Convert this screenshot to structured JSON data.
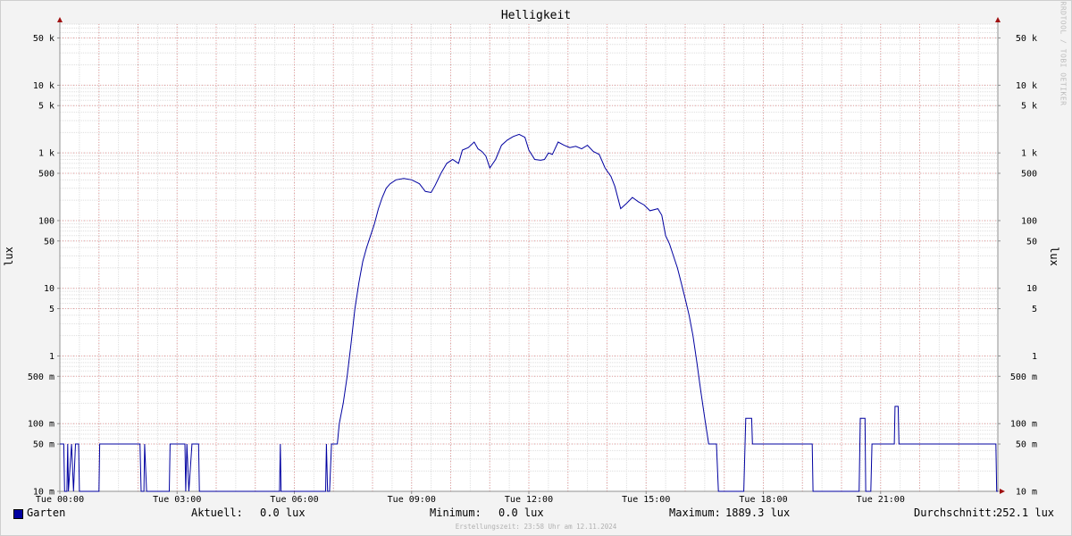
{
  "chart_data": {
    "type": "line",
    "title": "Helligkeit",
    "ylabel": "lux",
    "y_scale": "log",
    "ylim": [
      10,
      80000
    ],
    "grid": true,
    "y_ticks": [
      {
        "value": 50000,
        "label": "50 k"
      },
      {
        "value": 10000,
        "label": "10 k"
      },
      {
        "value": 5000,
        "label": "5 k"
      },
      {
        "value": 1000,
        "label": "1 k"
      },
      {
        "value": 500,
        "label": "500"
      },
      {
        "value": 100,
        "label": "100"
      },
      {
        "value": 50,
        "label": "50"
      },
      {
        "value": 10,
        "label": "10"
      },
      {
        "value": 5,
        "label": "5"
      },
      {
        "value": 1,
        "label": "1"
      },
      {
        "value": 0.5,
        "label": "500 m"
      },
      {
        "value": 0.1,
        "label": "100 m"
      },
      {
        "value": 0.05,
        "label": "50 m"
      },
      {
        "value": 0.01,
        "label": "10 m"
      }
    ],
    "x_ticks": [
      {
        "hour": 0,
        "label": "Tue 00:00"
      },
      {
        "hour": 3,
        "label": "Tue 03:00"
      },
      {
        "hour": 6,
        "label": "Tue 06:00"
      },
      {
        "hour": 9,
        "label": "Tue 09:00"
      },
      {
        "hour": 12,
        "label": "Tue 12:00"
      },
      {
        "hour": 15,
        "label": "Tue 15:00"
      },
      {
        "hour": 18,
        "label": "Tue 18:00"
      },
      {
        "hour": 21,
        "label": "Tue 21:00"
      }
    ],
    "series": [
      {
        "name": "Garten",
        "color": "#0000a0",
        "points": [
          [
            0.0,
            0.05
          ],
          [
            0.1,
            0.05
          ],
          [
            0.12,
            0.01
          ],
          [
            0.18,
            0.01
          ],
          [
            0.2,
            0.05
          ],
          [
            0.22,
            0.01
          ],
          [
            0.3,
            0.05
          ],
          [
            0.35,
            0.01
          ],
          [
            0.4,
            0.05
          ],
          [
            0.48,
            0.05
          ],
          [
            0.5,
            0.01
          ],
          [
            1.0,
            0.01
          ],
          [
            1.02,
            0.05
          ],
          [
            2.05,
            0.05
          ],
          [
            2.08,
            0.01
          ],
          [
            2.15,
            0.01
          ],
          [
            2.17,
            0.05
          ],
          [
            2.22,
            0.01
          ],
          [
            2.8,
            0.01
          ],
          [
            2.82,
            0.05
          ],
          [
            3.2,
            0.05
          ],
          [
            3.22,
            0.01
          ],
          [
            3.25,
            0.05
          ],
          [
            3.3,
            0.01
          ],
          [
            3.38,
            0.05
          ],
          [
            3.55,
            0.05
          ],
          [
            3.57,
            0.01
          ],
          [
            5.62,
            0.01
          ],
          [
            5.64,
            0.05
          ],
          [
            5.66,
            0.01
          ],
          [
            6.8,
            0.01
          ],
          [
            6.82,
            0.05
          ],
          [
            6.85,
            0.01
          ],
          [
            6.9,
            0.01
          ],
          [
            6.95,
            0.05
          ],
          [
            7.1,
            0.05
          ],
          [
            7.15,
            0.1
          ],
          [
            7.25,
            0.2
          ],
          [
            7.35,
            0.5
          ],
          [
            7.45,
            1.5
          ],
          [
            7.55,
            5
          ],
          [
            7.65,
            12
          ],
          [
            7.75,
            25
          ],
          [
            7.85,
            40
          ],
          [
            7.95,
            60
          ],
          [
            8.05,
            90
          ],
          [
            8.15,
            150
          ],
          [
            8.25,
            220
          ],
          [
            8.35,
            300
          ],
          [
            8.45,
            350
          ],
          [
            8.6,
            400
          ],
          [
            8.8,
            420
          ],
          [
            9.0,
            400
          ],
          [
            9.2,
            350
          ],
          [
            9.35,
            270
          ],
          [
            9.5,
            260
          ],
          [
            9.6,
            330
          ],
          [
            9.75,
            500
          ],
          [
            9.9,
            700
          ],
          [
            10.05,
            800
          ],
          [
            10.2,
            700
          ],
          [
            10.3,
            1100
          ],
          [
            10.45,
            1200
          ],
          [
            10.6,
            1450
          ],
          [
            10.7,
            1150
          ],
          [
            10.8,
            1050
          ],
          [
            10.9,
            900
          ],
          [
            11.0,
            600
          ],
          [
            11.15,
            800
          ],
          [
            11.3,
            1300
          ],
          [
            11.45,
            1550
          ],
          [
            11.6,
            1750
          ],
          [
            11.75,
            1880
          ],
          [
            11.9,
            1700
          ],
          [
            12.0,
            1100
          ],
          [
            12.15,
            800
          ],
          [
            12.3,
            780
          ],
          [
            12.4,
            800
          ],
          [
            12.5,
            1000
          ],
          [
            12.6,
            950
          ],
          [
            12.75,
            1450
          ],
          [
            12.9,
            1300
          ],
          [
            13.05,
            1200
          ],
          [
            13.2,
            1250
          ],
          [
            13.35,
            1150
          ],
          [
            13.5,
            1300
          ],
          [
            13.65,
            1050
          ],
          [
            13.8,
            950
          ],
          [
            13.95,
            600
          ],
          [
            14.1,
            450
          ],
          [
            14.2,
            320
          ],
          [
            14.35,
            150
          ],
          [
            14.5,
            180
          ],
          [
            14.65,
            220
          ],
          [
            14.8,
            190
          ],
          [
            14.95,
            170
          ],
          [
            15.1,
            140
          ],
          [
            15.3,
            150
          ],
          [
            15.4,
            120
          ],
          [
            15.5,
            60
          ],
          [
            15.6,
            45
          ],
          [
            15.7,
            30
          ],
          [
            15.8,
            20
          ],
          [
            15.9,
            12
          ],
          [
            16.0,
            7
          ],
          [
            16.1,
            4
          ],
          [
            16.2,
            2
          ],
          [
            16.3,
            0.8
          ],
          [
            16.4,
            0.3
          ],
          [
            16.5,
            0.12
          ],
          [
            16.6,
            0.05
          ],
          [
            16.8,
            0.05
          ],
          [
            16.85,
            0.01
          ],
          [
            17.5,
            0.01
          ],
          [
            17.55,
            0.12
          ],
          [
            17.7,
            0.12
          ],
          [
            17.72,
            0.05
          ],
          [
            19.25,
            0.05
          ],
          [
            19.27,
            0.01
          ],
          [
            20.45,
            0.01
          ],
          [
            20.48,
            0.12
          ],
          [
            20.6,
            0.12
          ],
          [
            20.62,
            0.01
          ],
          [
            20.75,
            0.01
          ],
          [
            20.78,
            0.05
          ],
          [
            21.35,
            0.05
          ],
          [
            21.37,
            0.18
          ],
          [
            21.45,
            0.18
          ],
          [
            21.47,
            0.05
          ],
          [
            23.95,
            0.05
          ],
          [
            23.97,
            0.01
          ],
          [
            24.0,
            0.01
          ]
        ]
      }
    ]
  },
  "legend": {
    "series_name": "Garten",
    "series_color": "#0000a0",
    "current_label": "Aktuell:",
    "current_value": "0.0 lux",
    "min_label": "Minimum:",
    "min_value": "0.0 lux",
    "max_label": "Maximum:",
    "max_value": "1889.3 lux",
    "avg_label": "Durchschnitt:",
    "avg_value": "252.1 lux"
  },
  "watermark": "RRDTOOL / TOBI OETIKER",
  "footer": "Erstellungszeit: 23:58 Uhr am 12.11.2024"
}
